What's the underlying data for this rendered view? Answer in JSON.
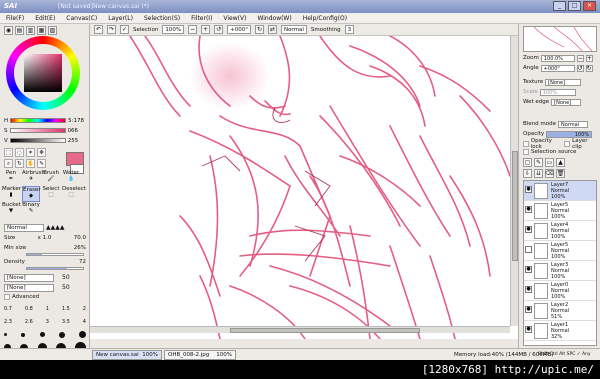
{
  "app": {
    "logo": "SAI",
    "window_title": "[Not saved]New canvas.sai (*)"
  },
  "window_buttons": [
    "_",
    "□",
    "✕"
  ],
  "menu": [
    "File(F)",
    "Edit(E)",
    "Canvas(C)",
    "Layer(L)",
    "Selection(S)",
    "Filter(I)",
    "View(V)",
    "Window(W)",
    "Help/Config(O)"
  ],
  "toolbar": {
    "selection_label": "Selection",
    "zoom": "100%",
    "angle": "+000°",
    "blend": "Normal",
    "smoothing_label": "Smoothing",
    "smoothing_value": "3"
  },
  "color": {
    "h_label": "H",
    "h_value": "5:178",
    "s_label": "S",
    "s_value": "066",
    "v_label": "V",
    "v_value": "255",
    "accent": "#e86a8a"
  },
  "tools": {
    "brushes": [
      "Pen",
      "Airbrush",
      "Brush",
      "Water",
      "Marker",
      "Eraser",
      "Select",
      "Deselect",
      "Bucket",
      "Binary"
    ],
    "selected": "Eraser"
  },
  "brush_props": {
    "normal_label": "Normal",
    "size_label": "Size",
    "size_mult": "x 1.0",
    "size_value": "70.0",
    "minsize_label": "Min size",
    "minsize_value": "26%",
    "minsize_pct": 26,
    "density_label": "Density",
    "density_value": "72",
    "density_pct": 72,
    "combo1": "[None]",
    "combo1_v": "50",
    "combo2": "[None]",
    "combo2_v": "50",
    "advanced_label": "Advanced",
    "dot_sizes": [
      [
        "0.7",
        "0.8",
        "1",
        "1.5",
        "2"
      ],
      [
        "2.3",
        "2.6",
        "3",
        "3.5",
        "4"
      ],
      [
        "5",
        "6",
        "7",
        "8",
        "9"
      ],
      [
        "10",
        "12",
        "14",
        "16",
        "20"
      ]
    ]
  },
  "right": {
    "zoom_label": "Zoom",
    "zoom_value": "100.0%",
    "angle_label": "Angle",
    "angle_value": "+000°",
    "texture_label": "Texture",
    "texture_value": "[None]",
    "scale_label": "Scale",
    "scale_value": "100%",
    "wetedge_label": "Wet edge",
    "wetedge_value": "[None]",
    "blendmode_label": "Blend mode",
    "blendmode_value": "Normal",
    "opacity_label": "Opacity",
    "opacity_value": "100%",
    "opacity_lock_label": "Opacity lock",
    "layer_clip_label": "Layer clip",
    "selection_source_label": "Selection source"
  },
  "layers": [
    {
      "name": "Layer7",
      "mode": "Normal",
      "opacity": "100%",
      "selected": true
    },
    {
      "name": "Layer5",
      "mode": "Normal",
      "opacity": "100%",
      "selected": false
    },
    {
      "name": "Layer4",
      "mode": "Normal",
      "opacity": "100%",
      "selected": false
    },
    {
      "name": "Layer5",
      "mode": "Normal",
      "opacity": "100%",
      "selected": false
    },
    {
      "name": "Layer3",
      "mode": "Normal",
      "opacity": "100%",
      "selected": false
    },
    {
      "name": "Layer0",
      "mode": "Normal",
      "opacity": "100%",
      "selected": false
    },
    {
      "name": "Layer2",
      "mode": "Normal",
      "opacity": "51%",
      "selected": false
    },
    {
      "name": "Layer1",
      "mode": "Normal",
      "opacity": "32%",
      "selected": false
    }
  ],
  "status": {
    "tab1": "New canvas.sai",
    "tab1_zoom": "100%",
    "tab2": "OHB_008-2.jpg",
    "tab2_zoom": "100%",
    "memory": "Memory load:40% (144MB / 606MB)",
    "keys": "Shift Ctrl Alt SPC ✓ Any"
  },
  "caption": "[1280x768] http://upic.me/"
}
